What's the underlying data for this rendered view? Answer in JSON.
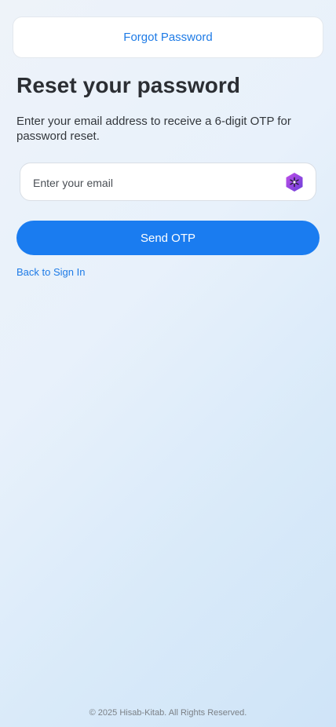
{
  "header": {
    "title": "Forgot Password"
  },
  "main": {
    "title": "Reset your password",
    "subtitle": "Enter your email address to receive a 6-digit OTP for password reset.",
    "email": {
      "placeholder": "Enter your email",
      "value": ""
    },
    "send_button_label": "Send OTP",
    "back_link_label": "Back to Sign In"
  },
  "footer": {
    "text": "© 2025 Hisab-Kitab. All Rights Reserved."
  },
  "icons": {
    "input_extension_icon": "hexagon-asterisk-icon"
  },
  "colors": {
    "accent": "#1a7cf0",
    "link": "#1e7be6",
    "icon_gradient_start": "#b14be8",
    "icon_gradient_end": "#6b3fd6"
  }
}
